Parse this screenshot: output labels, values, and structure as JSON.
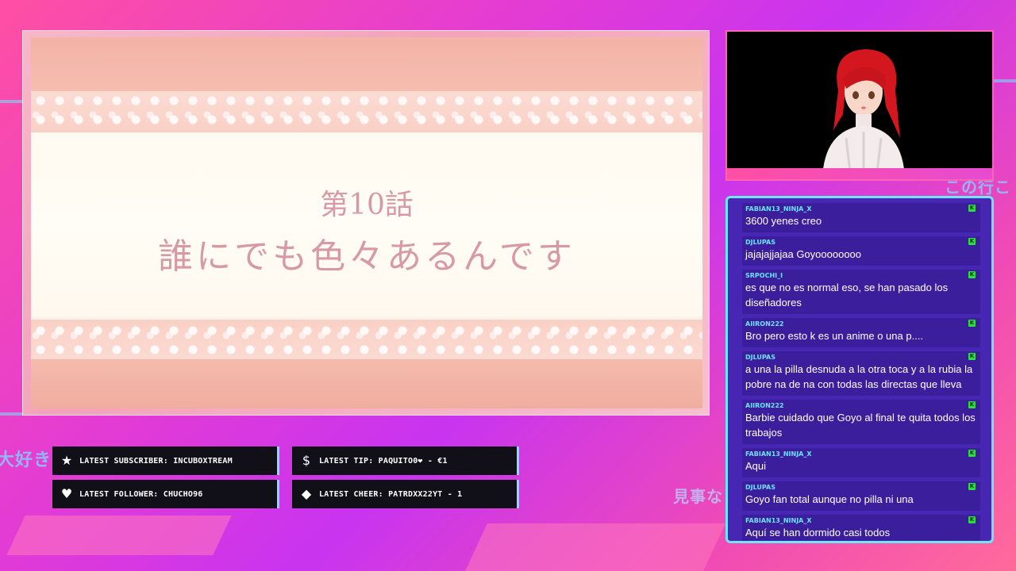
{
  "video": {
    "episode_number": "第10話",
    "episode_title": "誰にでも色々あるんです"
  },
  "background_text": {
    "left": "大好き",
    "right_top": "この行こ",
    "right_bottom": "見事な"
  },
  "alerts": [
    {
      "icon": "star-icon",
      "glyph": "★",
      "text": "LATEST SUBSCRIBER: INCUBOXTREAM"
    },
    {
      "icon": "dollar-icon",
      "glyph": "$",
      "text": "LATEST TIP: PAQUITO0❤ - €1"
    },
    {
      "icon": "heart-icon",
      "glyph": "♥",
      "text": "LATEST FOLLOWER: CHUCHO96"
    },
    {
      "icon": "diamond-icon",
      "glyph": "◆",
      "text": "LATEST CHEER: PATRDXX22YT - 1"
    }
  ],
  "chat": {
    "badge_glyph": "K",
    "messages": [
      {
        "user": "FABIAN13_NINJA_X",
        "text": "3600 yenes creo"
      },
      {
        "user": "DJLUPAS",
        "text": "jajajajjajaa Goyoooooooo"
      },
      {
        "user": "SRPOCHI_I",
        "text": "es que no es normal eso, se han pasado los diseñadores"
      },
      {
        "user": "AIIRON222",
        "text": "Bro pero esto k es un anime o una p...."
      },
      {
        "user": "DJLUPAS",
        "text": "a una la pilla desnuda a la otra toca y a la rubia la pobre na de na con todas las directas que lleva"
      },
      {
        "user": "AIIRON222",
        "text": "Barbie cuidado que Goyo al final te quita todos los trabajos"
      },
      {
        "user": "FABIAN13_NINJA_X",
        "text": "Aqui"
      },
      {
        "user": "DJLUPAS",
        "text": "Goyo fan total aunque no pilla ni una"
      },
      {
        "user": "FABIAN13_NINJA_X",
        "text": "Aquí se han dormido casi todos"
      }
    ]
  },
  "colors": {
    "accent_cyan": "#6ee6ff",
    "chat_bg": "#4826b4",
    "alert_bg": "#111018",
    "title_text": "#d79aa4"
  }
}
